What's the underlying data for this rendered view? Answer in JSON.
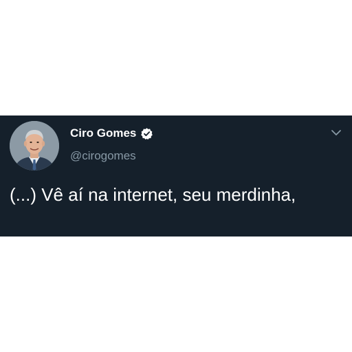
{
  "tweet": {
    "author": {
      "display_name": "Ciro Gomes",
      "handle": "@cirogomes",
      "verified": true,
      "avatar_icon": "profile-photo"
    },
    "text": "(...) Vê aí na internet, seu merdinha,",
    "menu_icon": "chevron-down-icon"
  },
  "colors": {
    "card_background": "#15202b",
    "name_text": "#ffffff",
    "handle_text": "#8899a6",
    "verified_badge": "#ffffff",
    "page_background": "#ffffff"
  }
}
